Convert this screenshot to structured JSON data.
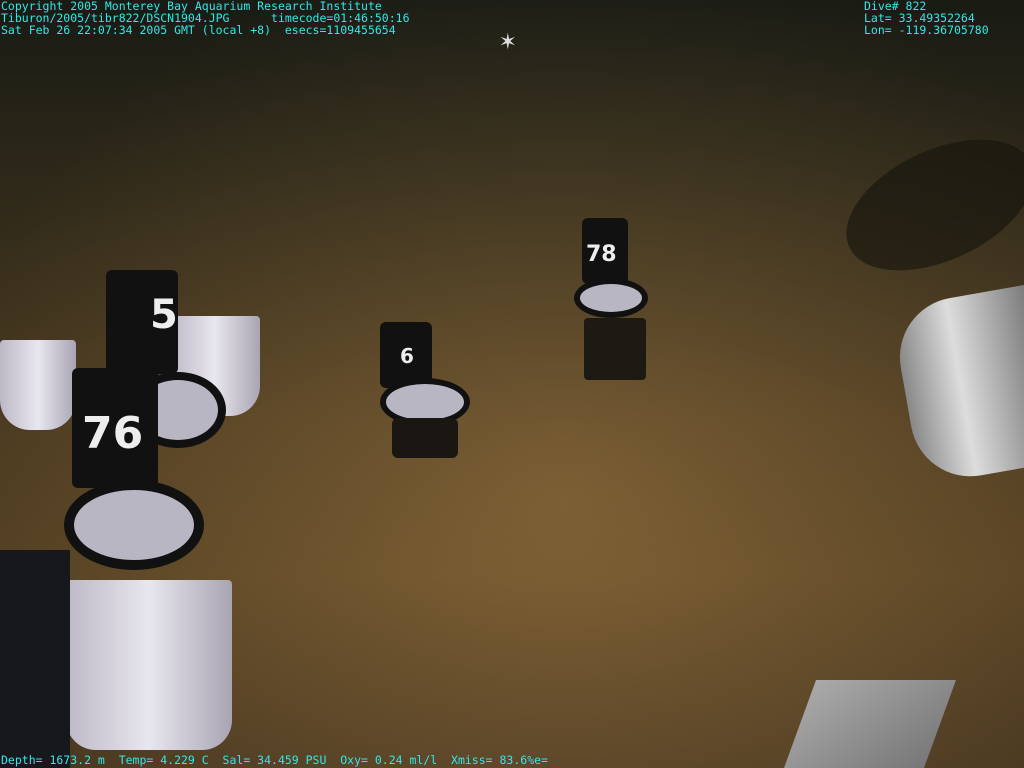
{
  "overlay_top_left": [
    "Copyright 2005 Monterey Bay Aquarium Research Institute",
    "Tiburon/2005/tibr822/DSCN1904.JPG      timecode=01:46:50:16",
    "Sat Feb 26 22:07:34 2005 GMT (local +8)  esecs=1109455654"
  ],
  "overlay_top_right": [
    "Dive# 822",
    "Lat= 33.49352264",
    "Lon= -119.36705780"
  ],
  "overlay_bottom": "Depth= 1673.2 m  Temp= 4.229 C  Sal= 34.459 PSU  Oxy= 0.24 ml/l  Xmiss= 83.6%e=",
  "core_labels": [
    "5",
    "76",
    "78",
    "6"
  ]
}
